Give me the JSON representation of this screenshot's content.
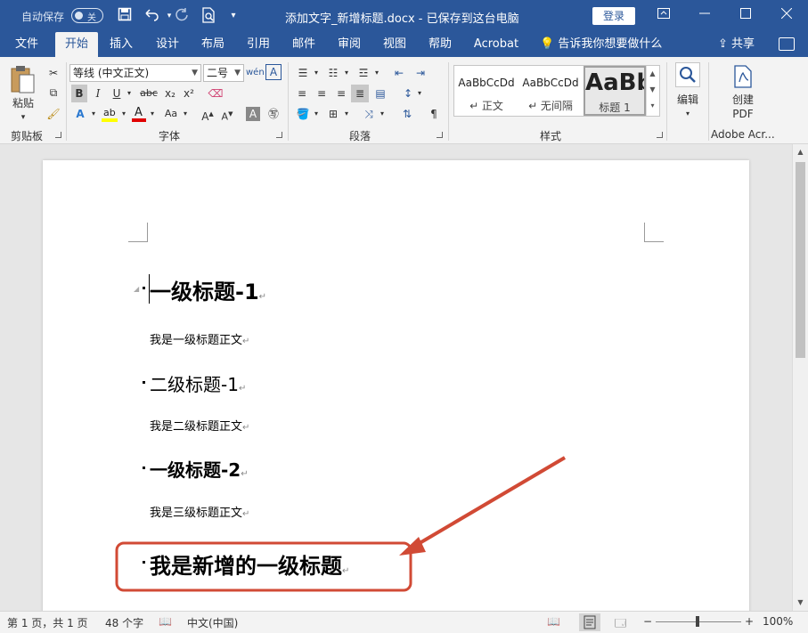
{
  "titlebar": {
    "autosave_label": "自动保存",
    "autosave_state": "关",
    "title": "添加文字_新增标题.docx  -  已保存到这台电脑",
    "login_label": "登录"
  },
  "tabs": [
    {
      "label": "文件"
    },
    {
      "label": "开始"
    },
    {
      "label": "插入"
    },
    {
      "label": "设计"
    },
    {
      "label": "布局"
    },
    {
      "label": "引用"
    },
    {
      "label": "邮件"
    },
    {
      "label": "审阅"
    },
    {
      "label": "视图"
    },
    {
      "label": "帮助"
    },
    {
      "label": "Acrobat"
    }
  ],
  "tell_me": "告诉我你想要做什么",
  "share_label": "共享",
  "ribbon": {
    "paste_label": "粘贴",
    "font_name": "等线 (中文正文)",
    "font_size": "二号",
    "groups": {
      "clipboard": "剪贴板",
      "font": "字体",
      "paragraph": "段落",
      "styles": "样式",
      "editing": "编辑",
      "adobe": "Adobe Acr..."
    },
    "styles": [
      {
        "sample": "AaBbCcDd",
        "name": "↵ 正文"
      },
      {
        "sample": "AaBbCcDd",
        "name": "↵ 无间隔"
      },
      {
        "sample": "AaBb",
        "name": "标题 1"
      }
    ],
    "create_pdf_label": "创建",
    "create_pdf_label2": "PDF",
    "editing_label": "编辑",
    "bold": "B",
    "italic": "I",
    "underline": "U",
    "strike": "abc",
    "sub": "x₂",
    "sup": "x²"
  },
  "document": {
    "paragraphs": [
      {
        "text": "一级标题-1",
        "style": "h1"
      },
      {
        "text": "我是一级标题正文",
        "style": "body"
      },
      {
        "text": "二级标题-1",
        "style": "h2"
      },
      {
        "text": "我是二级标题正文",
        "style": "body"
      },
      {
        "text": "一级标题-2",
        "style": "h1"
      },
      {
        "text": "我是三级标题正文",
        "style": "body"
      },
      {
        "text": "我是新增的一级标题",
        "style": "h1"
      }
    ],
    "paragraph_mark": "↵"
  },
  "annotation": {
    "color": "#d14a35"
  },
  "status": {
    "page": "第 1 页，共 1 页",
    "words": "48 个字",
    "language": "中文(中国)",
    "zoom": "100%",
    "zoom_minus": "−",
    "zoom_plus": "+"
  },
  "colors": {
    "brand": "#2b579a",
    "font_color_bar": "#e00000",
    "highlight_bar": "#ffff00"
  }
}
